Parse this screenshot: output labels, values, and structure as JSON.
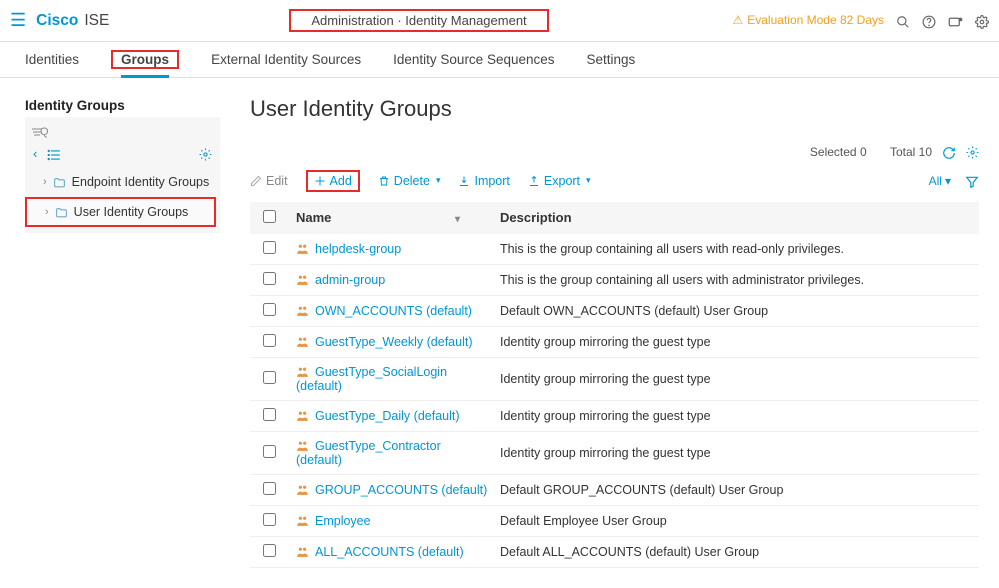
{
  "header": {
    "brand": "Cisco",
    "product": "ISE",
    "breadcrumb": "Administration · Identity Management",
    "eval_text": "Evaluation Mode 82 Days"
  },
  "tabs": [
    {
      "key": "identities",
      "label": "Identities"
    },
    {
      "key": "groups",
      "label": "Groups"
    },
    {
      "key": "ext",
      "label": "External Identity Sources"
    },
    {
      "key": "seq",
      "label": "Identity Source Sequences"
    },
    {
      "key": "settings",
      "label": "Settings"
    }
  ],
  "sidebar": {
    "title": "Identity Groups",
    "search_placeholder": "",
    "tree": [
      {
        "label": "Endpoint Identity Groups"
      },
      {
        "label": "User Identity Groups"
      }
    ]
  },
  "main": {
    "title": "User Identity Groups",
    "selected_text": "Selected 0",
    "total_text": "Total 10",
    "toolbar": {
      "edit": "Edit",
      "add": "Add",
      "delete": "Delete",
      "import": "Import",
      "export": "Export",
      "all": "All"
    },
    "columns": {
      "name": "Name",
      "description": "Description"
    },
    "rows": [
      {
        "name": "helpdesk-group",
        "desc": "This is the group containing all users with read-only privileges."
      },
      {
        "name": "admin-group",
        "desc": "This is the group containing all users with administrator privileges."
      },
      {
        "name": "OWN_ACCOUNTS (default)",
        "desc": "Default OWN_ACCOUNTS (default) User Group"
      },
      {
        "name": "GuestType_Weekly (default)",
        "desc": "Identity group mirroring the guest type"
      },
      {
        "name": "GuestType_SocialLogin (default)",
        "desc": "Identity group mirroring the guest type"
      },
      {
        "name": "GuestType_Daily (default)",
        "desc": "Identity group mirroring the guest type"
      },
      {
        "name": "GuestType_Contractor (default)",
        "desc": "Identity group mirroring the guest type"
      },
      {
        "name": "GROUP_ACCOUNTS (default)",
        "desc": "Default GROUP_ACCOUNTS (default) User Group"
      },
      {
        "name": "Employee",
        "desc": "Default Employee User Group"
      },
      {
        "name": "ALL_ACCOUNTS (default)",
        "desc": "Default ALL_ACCOUNTS (default) User Group"
      }
    ]
  }
}
